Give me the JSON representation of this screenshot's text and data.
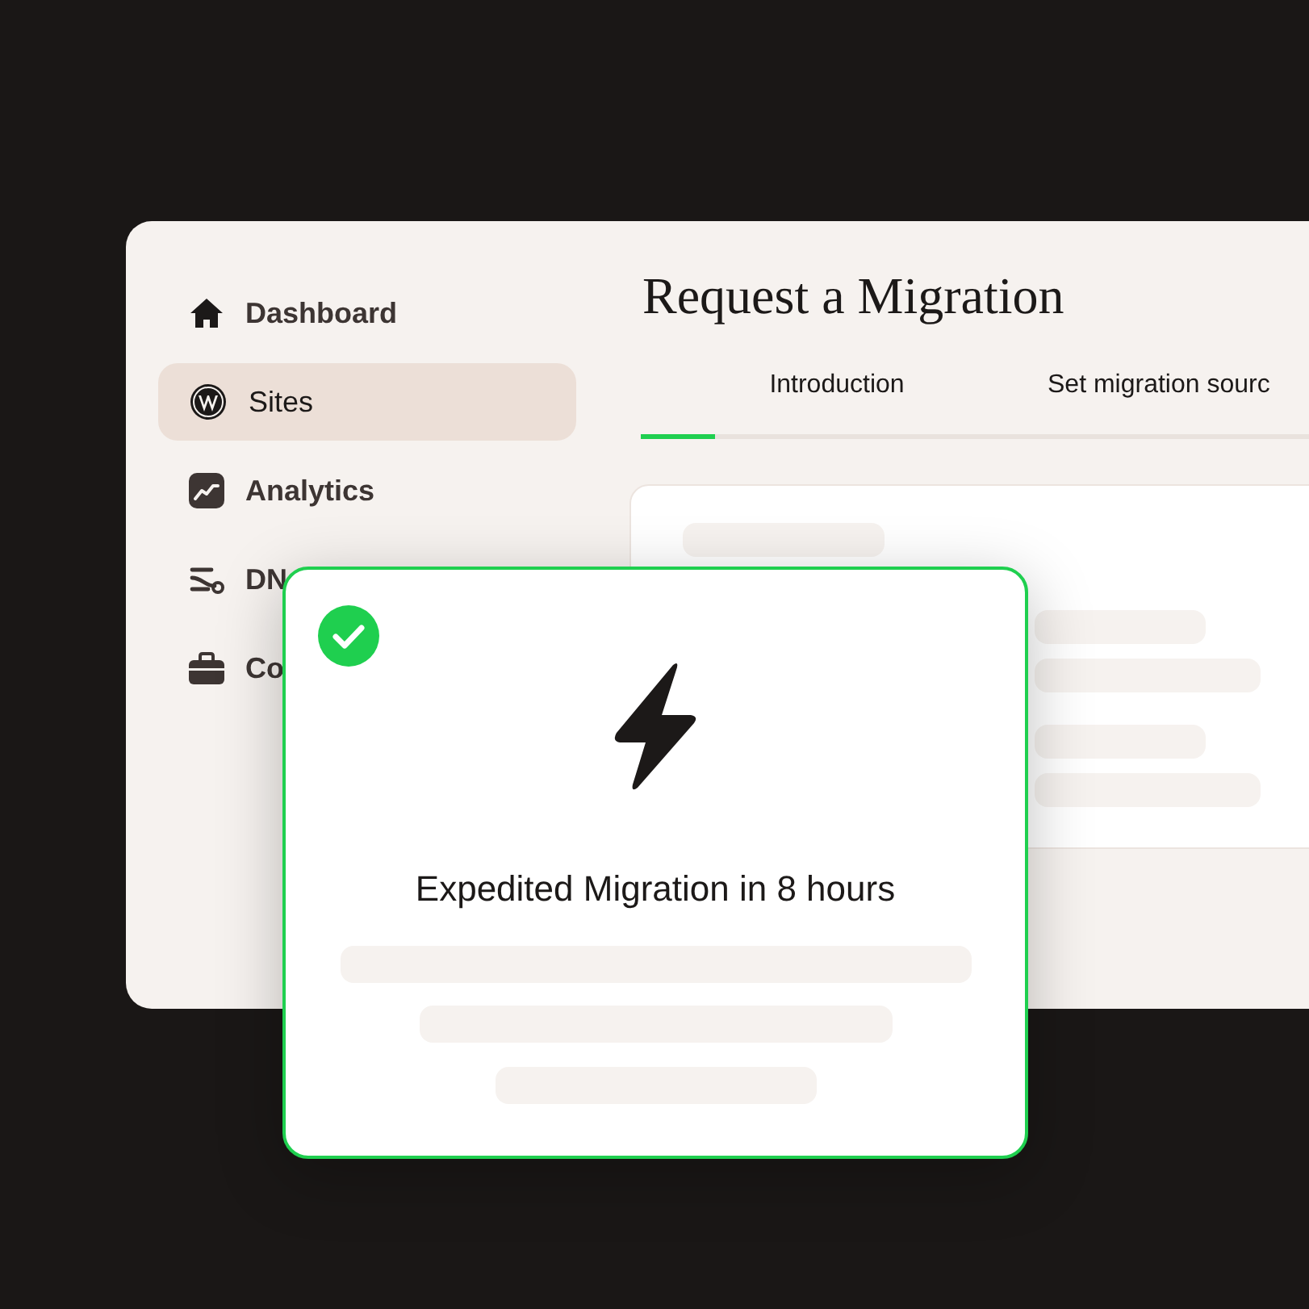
{
  "sidebar": {
    "items": [
      {
        "label": "Dashboard",
        "selected": false
      },
      {
        "label": "Sites",
        "selected": true
      },
      {
        "label": "Analytics",
        "selected": false
      },
      {
        "label": "DN",
        "selected": false
      },
      {
        "label": "Co",
        "selected": false
      }
    ]
  },
  "main": {
    "title": "Request a Migration",
    "steps": [
      {
        "label": "Introduction"
      },
      {
        "label": "Set migration sourc"
      }
    ],
    "progress": {
      "level": 0.1
    }
  },
  "overlay_card": {
    "checked": true,
    "title": "Expedited Migration in 8 hours"
  }
}
